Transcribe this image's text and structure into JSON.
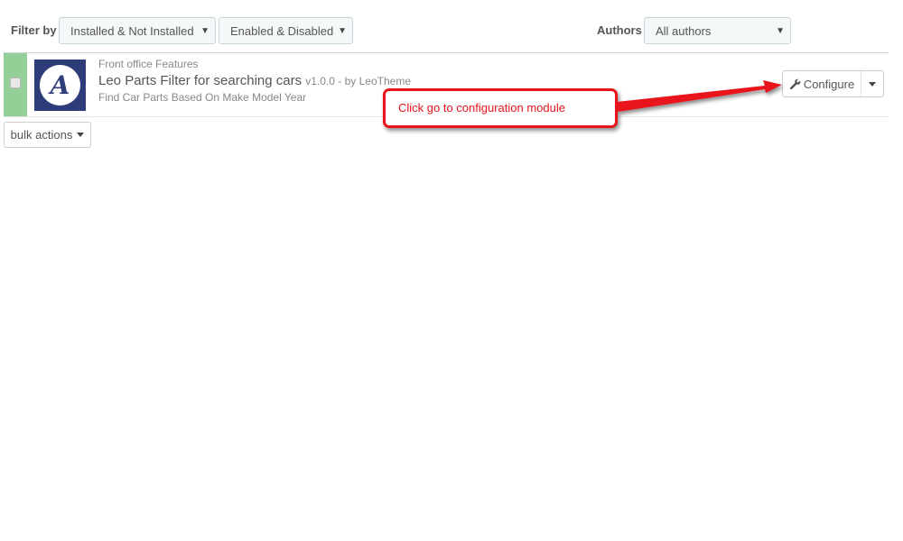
{
  "filters": {
    "filter_by_label": "Filter by",
    "install_select": "Installed & Not Installed",
    "status_select": "Enabled & Disabled",
    "authors_label": "Authors",
    "authors_select": "All authors"
  },
  "module": {
    "category": "Front office Features",
    "title": "Leo Parts Filter for searching cars",
    "meta": "v1.0.0 - by LeoTheme",
    "description": "Find Car Parts Based On Make Model Year",
    "logo_letter": "A",
    "configure_label": "Configure"
  },
  "bulk": {
    "label": "bulk actions"
  },
  "annotation": {
    "text": "Click go to configuration module"
  },
  "colors": {
    "enabled_bar": "#93cf96",
    "logo_bg": "#2f3c7a",
    "annotation_red": "#e8141b"
  },
  "icons": {
    "configure": "wrench-icon",
    "select_arrow": "caret-down-icon"
  }
}
